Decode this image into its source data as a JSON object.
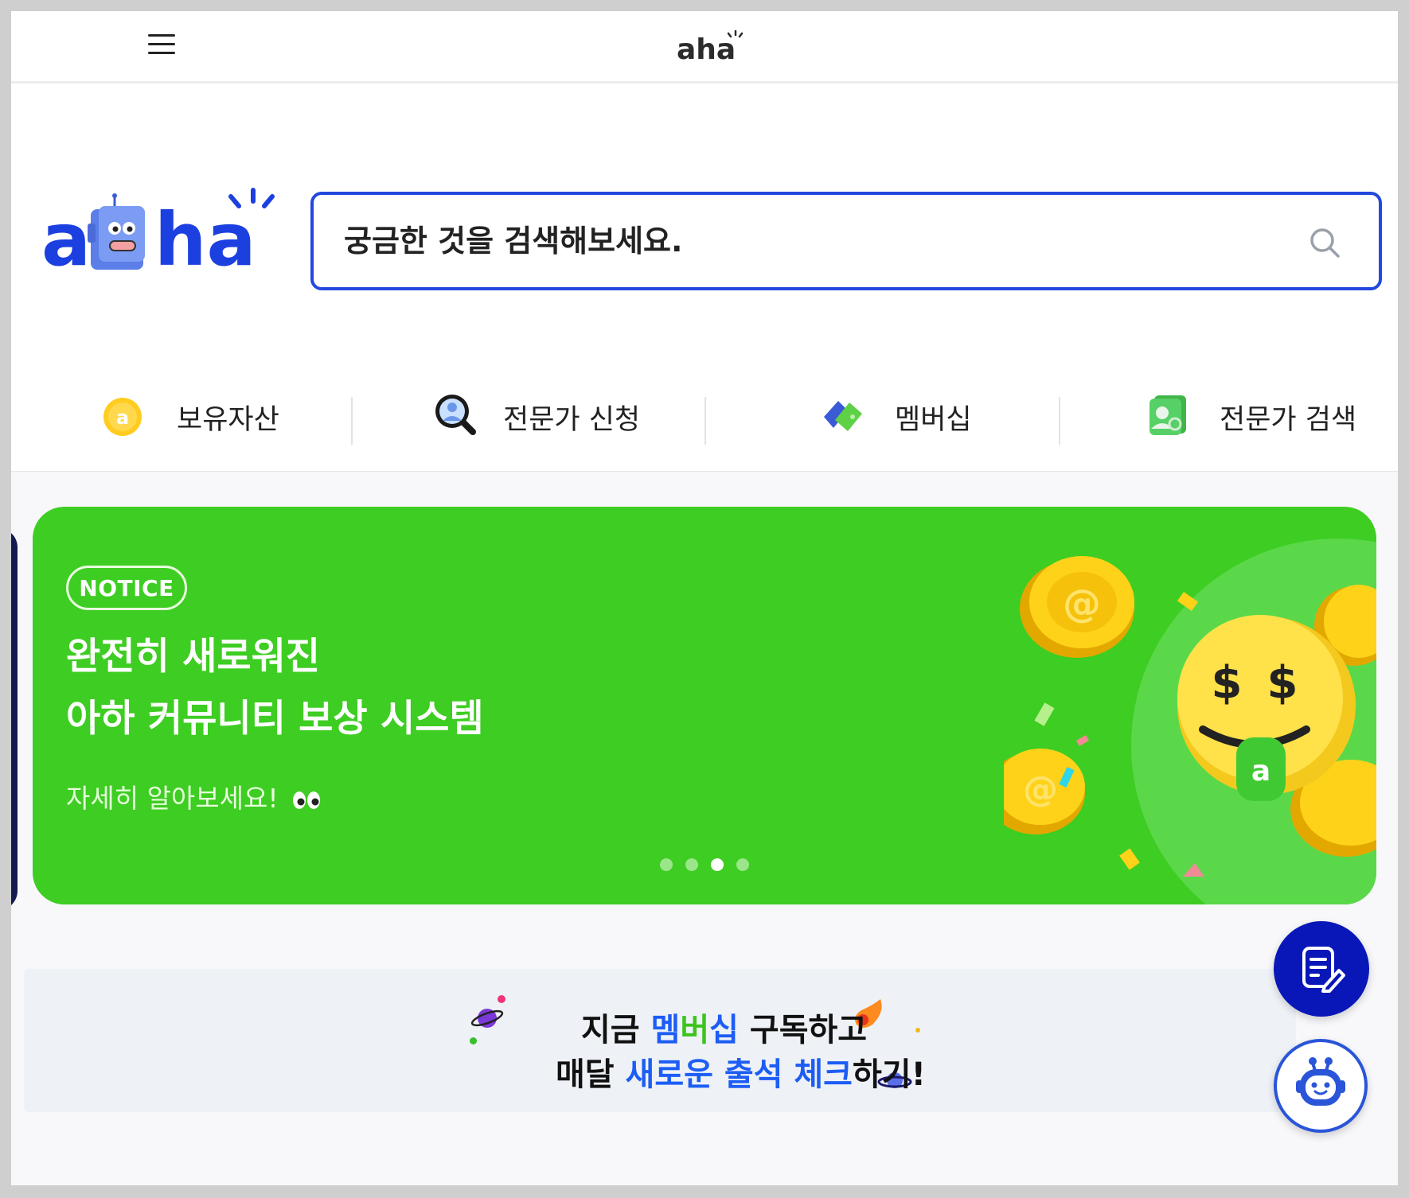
{
  "topbar": {
    "menu_icon": "hamburger-menu-icon",
    "logo_text": "aha"
  },
  "header": {
    "logo_text": "aha",
    "search": {
      "placeholder": "궁금한 것을 검색해보세요.",
      "icon": "search-icon"
    },
    "menu": [
      {
        "label": "보유자산",
        "icon": "coin-icon"
      },
      {
        "label": "전문가 신청",
        "icon": "magnifier-person-icon"
      },
      {
        "label": "멤버십",
        "icon": "card-icon"
      },
      {
        "label": "전문가 검색",
        "icon": "expert-profile-icon"
      }
    ]
  },
  "banner": {
    "badge": "NOTICE",
    "title_line1": "완전히 새로워진",
    "title_line2": "아하 커뮤니티 보상 시스템",
    "subtitle": "자세히 알아보세요!",
    "slides_total": 4,
    "active_slide": 3,
    "background": "#3ecd22"
  },
  "promo": {
    "line1_prefix": "지금 ",
    "line1_highlight_a": "멤",
    "line1_highlight_b": "버",
    "line1_highlight_c": "십",
    "line1_suffix": " 구독하고",
    "line2_prefix": "매달 ",
    "line2_highlight_a": "새로운 출석 체크",
    "line2_suffix": "하기!"
  },
  "fabs": {
    "write_icon": "write-note-icon",
    "bot_icon": "robot-assistant-icon"
  },
  "colors": {
    "brand_blue": "#2348dd",
    "fab_blue": "#0a17b8",
    "banner_green": "#3ecd22"
  }
}
